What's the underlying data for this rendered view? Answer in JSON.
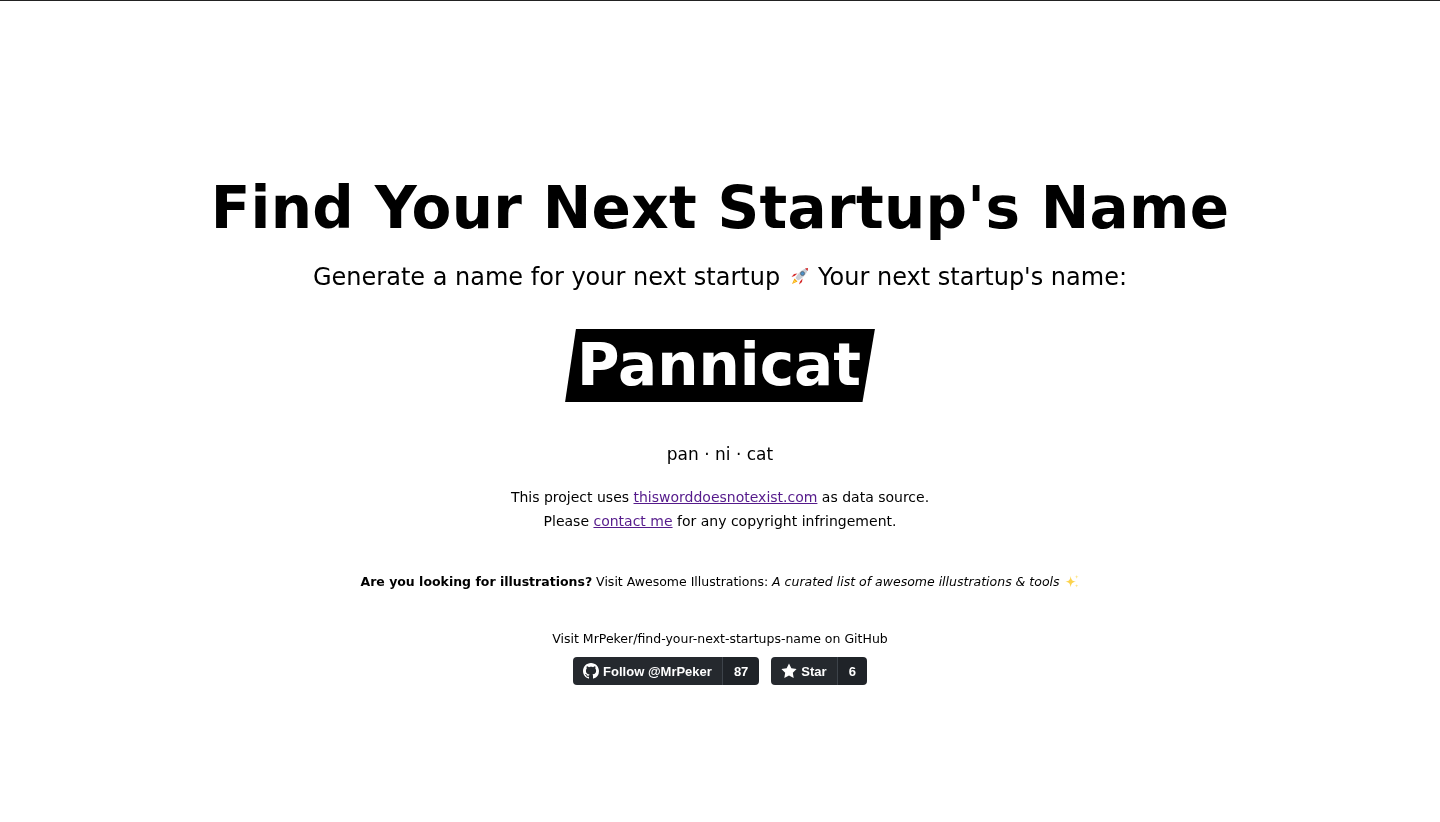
{
  "title": "Find Your Next Startup's Name",
  "subtitle": {
    "text": "Generate a name for your next startup",
    "prompt": "Your next startup's name:"
  },
  "generated_name": {
    "word": "Pannicat",
    "syllables": "pan · ni · cat"
  },
  "notes": [
    {
      "before": "This project uses ",
      "link": "thisworddoesnotexist.com",
      "after": " as data source."
    },
    {
      "before": "Please ",
      "link": "contact me",
      "after": " for any copyright infringement."
    }
  ],
  "promo": {
    "text": "**Are you looking for illustrations?** Visit Awesome Illustrations: *A curated list of awesome illustrations & tools*"
  },
  "github": {
    "caption": "Visit MrPeker/find-your-next-startups-name on GitHub",
    "buttons": [
      {
        "kind": "follow",
        "label": "Follow @MrPeker",
        "count": "87"
      },
      {
        "kind": "star",
        "label": "Star",
        "count": "6"
      }
    ]
  }
}
